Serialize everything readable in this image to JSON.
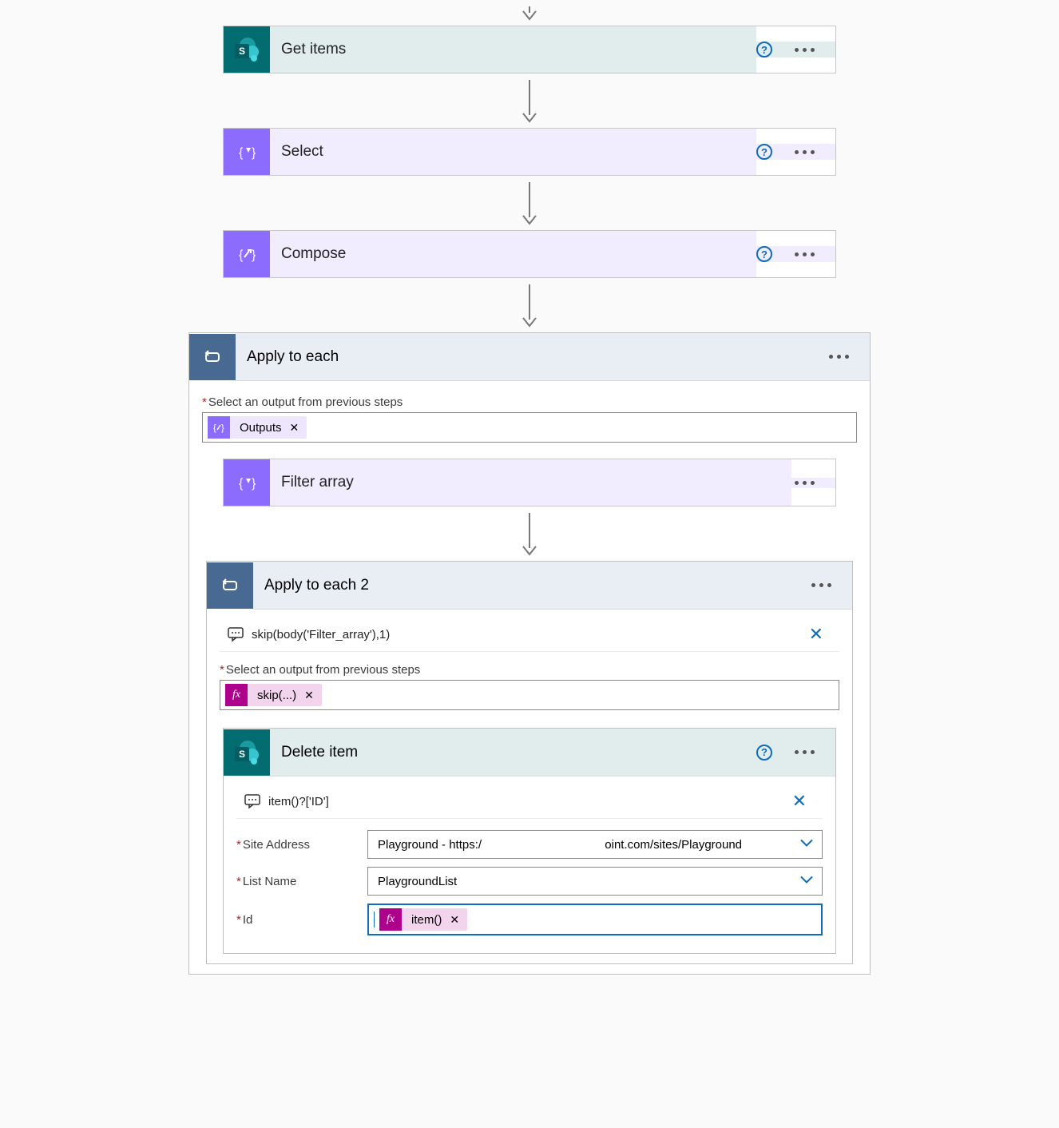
{
  "cards": {
    "getItems": {
      "title": "Get items"
    },
    "select": {
      "title": "Select"
    },
    "compose": {
      "title": "Compose"
    },
    "filterArray": {
      "title": "Filter array"
    },
    "deleteItem": {
      "title": "Delete item"
    }
  },
  "applyEach1": {
    "title": "Apply to each",
    "fieldLabel": "Select an output from previous steps",
    "token": "Outputs"
  },
  "applyEach2": {
    "title": "Apply to each 2",
    "peekCode": "skip(body('Filter_array'),1)",
    "fieldLabel": "Select an output from previous steps",
    "token": "skip(...)"
  },
  "deleteItemForm": {
    "peekCode": "item()?['ID']",
    "siteAddressLabel": "Site Address",
    "siteAddressValue": "Playground - https:/                                     oint.com/sites/Playground",
    "listNameLabel": "List Name",
    "listNameValue": "PlaygroundList",
    "idLabel": "Id",
    "idToken": "item()"
  },
  "glyphs": {
    "sharepointLetter": "S",
    "fx": "fx",
    "tokenClose": "✕",
    "close": "✕",
    "help": "?"
  }
}
